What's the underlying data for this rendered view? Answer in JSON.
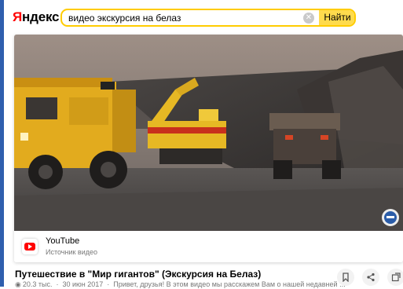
{
  "header": {
    "logo_prefix": "Я",
    "logo_rest": "ндекс",
    "search_value": "видео экскурсия на белаз",
    "search_button": "Найти",
    "clear_icon": "close-icon"
  },
  "video": {
    "watermark_icon": "channel-logo-icon",
    "source_name": "YouTube",
    "source_sub": "Источник видео"
  },
  "result": {
    "title": "Путешествие в \"Мир гигантов\" (Экскурсия на Белаз)",
    "views": "20.3 тыс.",
    "date": "30 июн 2017",
    "snippet": "Привет, друзья! В этом видео мы расскажем Вам о нашей недавней ..."
  },
  "actions": {
    "bookmark_icon": "bookmark-icon",
    "share_icon": "share-icon",
    "more_icon": "external-icon"
  }
}
